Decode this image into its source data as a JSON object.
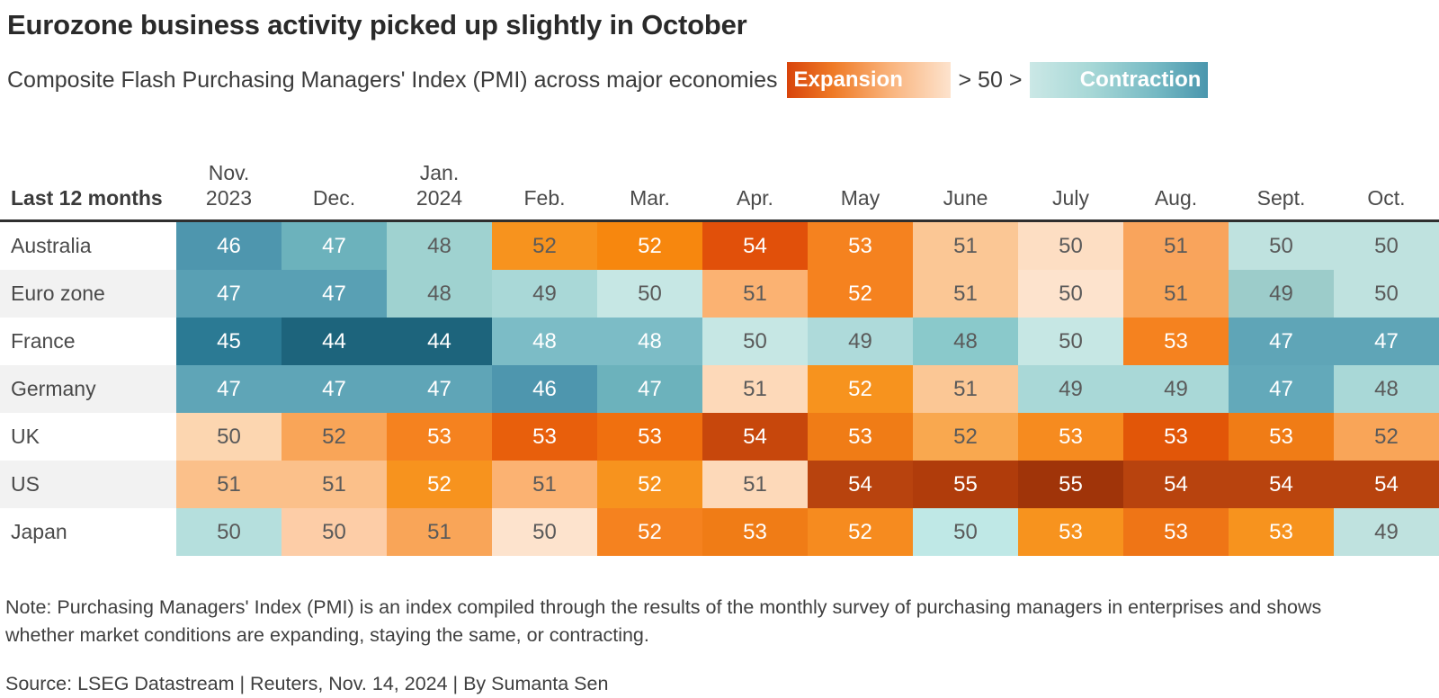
{
  "header": {
    "title": "Eurozone business activity picked up slightly in October",
    "subtitle": "Composite Flash Purchasing Managers' Index (PMI) across major economies",
    "legend": {
      "expansion_label": "Expansion",
      "middle_label": "> 50 >",
      "contraction_label": "Contraction",
      "expansion_color": "#d8440b",
      "contraction_color": "#4a96ad"
    }
  },
  "table": {
    "corner_label": "Last 12\nmonths",
    "columns": [
      "Nov.\n2023",
      "Dec.",
      "Jan.\n2024",
      "Feb.",
      "Mar.",
      "Apr.",
      "May",
      "June",
      "July",
      "Aug.",
      "Sept.",
      "Oct."
    ]
  },
  "footer": {
    "note": "Note: Purchasing Managers' Index (PMI) is an index compiled through the results of the monthly survey of purchasing managers in enterprises and shows whether market conditions are expanding, staying the same, or contracting.",
    "source": "Source: LSEG Datastream | Reuters, Nov. 14, 2024 | By Sumanta Sen"
  },
  "chart_data": {
    "type": "heatmap",
    "title": "Eurozone business activity picked up slightly in October",
    "subtitle": "Composite Flash Purchasing Managers' Index (PMI) across major economies",
    "xlabel": "",
    "ylabel": "",
    "x_categories": [
      "Nov. 2023",
      "Dec.",
      "Jan. 2024",
      "Feb.",
      "Mar.",
      "Apr.",
      "May",
      "June",
      "July",
      "Aug.",
      "Sept.",
      "Oct."
    ],
    "y_categories": [
      "Australia",
      "Euro zone",
      "France",
      "Germany",
      "UK",
      "US",
      "Japan"
    ],
    "midpoint": 50,
    "colorscale": {
      "below_50": [
        "#cfe9e6",
        "#a9d8d7",
        "#7cbcc6",
        "#4e99b0",
        "#2b7a94",
        "#1d647c"
      ],
      "above_50": [
        "#fde4d0",
        "#fbcba3",
        "#f9a967",
        "#f5821f",
        "#e25608",
        "#a83a0d"
      ]
    },
    "rows": [
      {
        "label": "Australia",
        "values": [
          46,
          47,
          48,
          52,
          52,
          54,
          53,
          51,
          50,
          51,
          50,
          50
        ],
        "colors": [
          "#4e96ae",
          "#6cb2bc",
          "#9fd2d0",
          "#f7931e",
          "#f7870e",
          "#e1500a",
          "#f5821f",
          "#fbc795",
          "#fddec3",
          "#f9a45c",
          "#bfe2df",
          "#bfe2df"
        ],
        "text_colors": [
          "#ffffff",
          "#ffffff",
          "#5a5a5a",
          "#5a5a5a",
          "#ffffff",
          "#ffffff",
          "#ffffff",
          "#5a5a5a",
          "#5a5a5a",
          "#5a5a5a",
          "#5a5a5a",
          "#5a5a5a"
        ]
      },
      {
        "label": "Euro zone",
        "values": [
          47,
          47,
          48,
          49,
          50,
          51,
          52,
          51,
          50,
          51,
          49,
          50
        ],
        "colors": [
          "#59a0b4",
          "#59a0b4",
          "#9fd2d0",
          "#a9d8d7",
          "#c6e7e4",
          "#fbb272",
          "#f5821f",
          "#fbc795",
          "#fde3cd",
          "#f9a558",
          "#9cccca",
          "#bfe2df"
        ],
        "text_colors": [
          "#ffffff",
          "#ffffff",
          "#5a5a5a",
          "#5a5a5a",
          "#5a5a5a",
          "#5a5a5a",
          "#ffffff",
          "#5a5a5a",
          "#5a5a5a",
          "#5a5a5a",
          "#5a5a5a",
          "#5a5a5a"
        ]
      },
      {
        "label": "France",
        "values": [
          45,
          44,
          44,
          48,
          48,
          50,
          49,
          48,
          50,
          53,
          47,
          47
        ],
        "colors": [
          "#2b7a94",
          "#1d647c",
          "#1d647c",
          "#7cbcc6",
          "#7cbcc6",
          "#c6e7e4",
          "#aedada",
          "#8ac9cb",
          "#c6e7e4",
          "#f5821f",
          "#5fa5b7",
          "#5fa5b7"
        ],
        "text_colors": [
          "#ffffff",
          "#ffffff",
          "#ffffff",
          "#ffffff",
          "#ffffff",
          "#5a5a5a",
          "#5a5a5a",
          "#5a5a5a",
          "#5a5a5a",
          "#ffffff",
          "#ffffff",
          "#ffffff"
        ]
      },
      {
        "label": "Germany",
        "values": [
          47,
          47,
          47,
          46,
          47,
          51,
          52,
          51,
          49,
          49,
          47,
          48
        ],
        "colors": [
          "#5fa5b7",
          "#5fa5b7",
          "#5fa5b7",
          "#4e96ae",
          "#6cb2bc",
          "#fdd9b9",
          "#f7931e",
          "#fbc795",
          "#a9d8d7",
          "#a9d8d7",
          "#63a9ba",
          "#a9d8d7"
        ],
        "text_colors": [
          "#ffffff",
          "#ffffff",
          "#ffffff",
          "#ffffff",
          "#ffffff",
          "#5a5a5a",
          "#ffffff",
          "#5a5a5a",
          "#5a5a5a",
          "#5a5a5a",
          "#ffffff",
          "#5a5a5a"
        ]
      },
      {
        "label": "UK",
        "values": [
          50,
          52,
          53,
          53,
          53,
          54,
          53,
          52,
          53,
          53,
          53,
          52
        ],
        "colors": [
          "#fcd6b0",
          "#f9a558",
          "#f5821f",
          "#e85f0c",
          "#f0700f",
          "#c7470c",
          "#f07c16",
          "#f9a84f",
          "#f68b1f",
          "#e25608",
          "#f07c16",
          "#f9a558"
        ],
        "text_colors": [
          "#5a5a5a",
          "#5a5a5a",
          "#ffffff",
          "#ffffff",
          "#ffffff",
          "#ffffff",
          "#ffffff",
          "#5a5a5a",
          "#ffffff",
          "#ffffff",
          "#ffffff",
          "#5a5a5a"
        ]
      },
      {
        "label": "US",
        "values": [
          51,
          51,
          52,
          51,
          52,
          51,
          54,
          55,
          55,
          54,
          54,
          54
        ],
        "colors": [
          "#fbc08a",
          "#fbc08a",
          "#f7931e",
          "#fbb272",
          "#f7931e",
          "#fdd9b9",
          "#b8430e",
          "#b03c0b",
          "#a03409",
          "#b8430e",
          "#b8430e",
          "#b8430e"
        ],
        "text_colors": [
          "#5a5a5a",
          "#5a5a5a",
          "#ffffff",
          "#5a5a5a",
          "#ffffff",
          "#5a5a5a",
          "#ffffff",
          "#ffffff",
          "#ffffff",
          "#ffffff",
          "#ffffff",
          "#ffffff"
        ]
      },
      {
        "label": "Japan",
        "values": [
          50,
          50,
          51,
          50,
          52,
          53,
          52,
          50,
          53,
          53,
          53,
          49
        ],
        "colors": [
          "#b5dfdd",
          "#fdcda7",
          "#f9a558",
          "#fde3cd",
          "#f5821f",
          "#f07c16",
          "#f68b1f",
          "#bfe8e6",
          "#f7931e",
          "#ef7516",
          "#f7931e",
          "#bfe2df"
        ],
        "text_colors": [
          "#5a5a5a",
          "#5a5a5a",
          "#5a5a5a",
          "#5a5a5a",
          "#ffffff",
          "#ffffff",
          "#ffffff",
          "#5a5a5a",
          "#ffffff",
          "#ffffff",
          "#ffffff",
          "#5a5a5a"
        ]
      }
    ]
  }
}
